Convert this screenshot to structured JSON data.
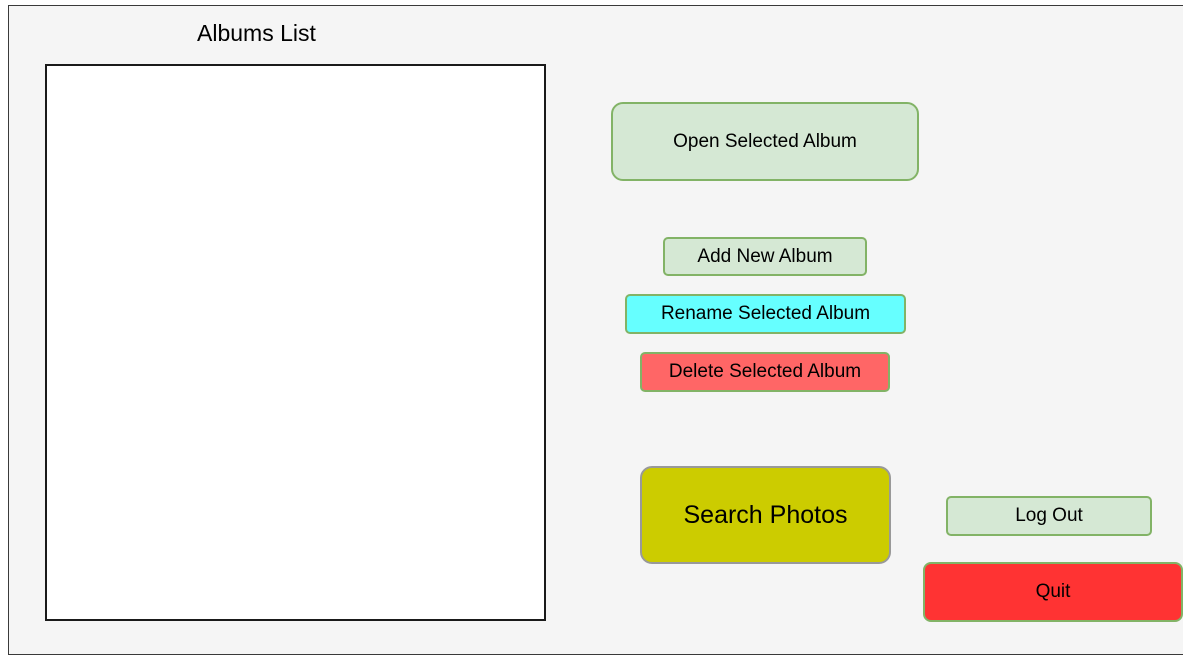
{
  "albums_panel": {
    "title": "Albums List",
    "items": []
  },
  "actions": {
    "open_label": "Open Selected Album",
    "add_label": "Add New Album",
    "rename_label": "Rename Selected Album",
    "delete_label": "Delete Selected Album",
    "search_label": "Search Photos",
    "logout_label": "Log Out",
    "quit_label": "Quit"
  },
  "colors": {
    "window_background": "#f5f5f5",
    "list_background": "#ffffff",
    "default_button": "#d5e8d4",
    "default_button_border": "#82b366",
    "rename_button": "#66ffff",
    "delete_button": "#ff6666",
    "search_button": "#cccc00",
    "quit_button": "#ff3333"
  }
}
